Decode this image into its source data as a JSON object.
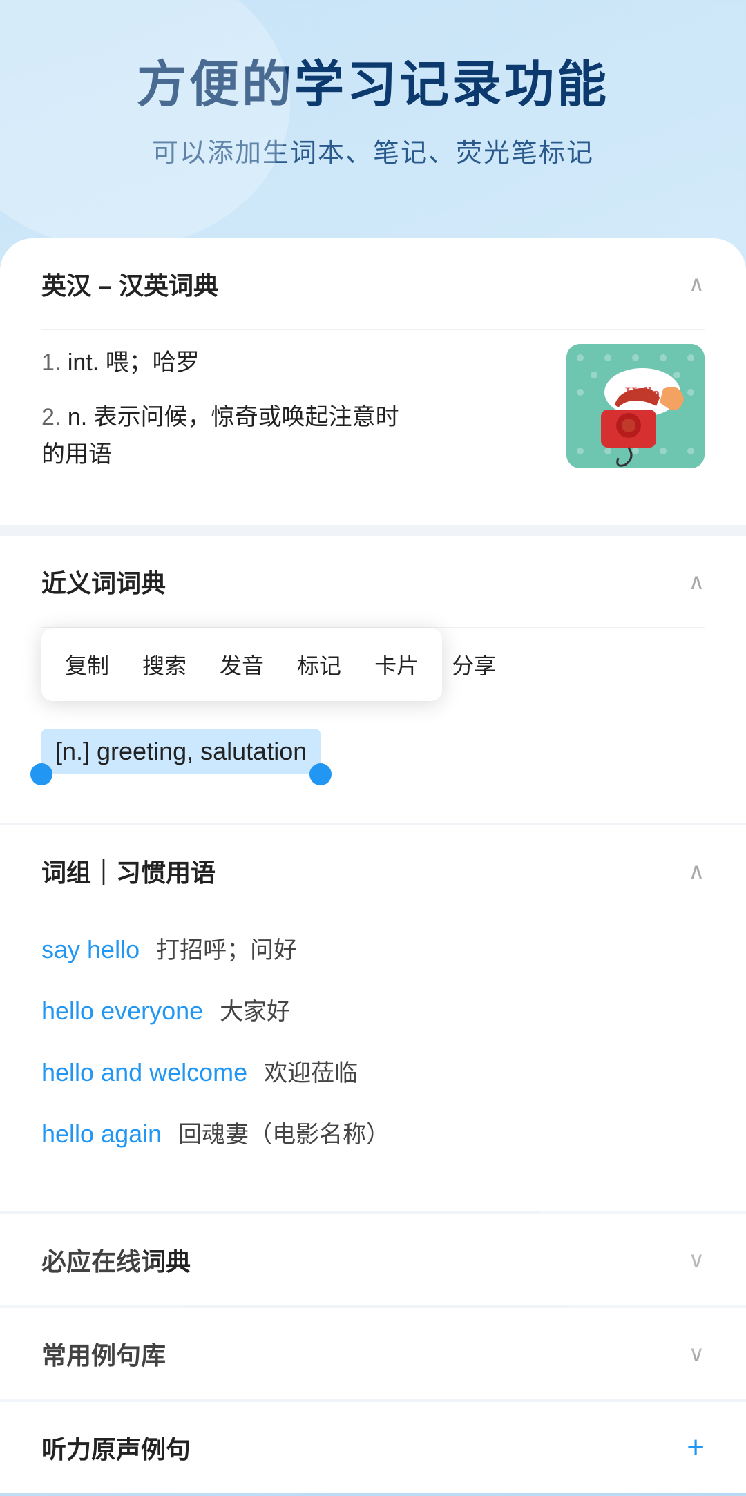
{
  "header": {
    "title": "方便的学习记录功能",
    "subtitle": "可以添加生词本、笔记、荧光笔标记"
  },
  "sections": {
    "dict": {
      "title": "英汉 – 汉英词典",
      "entries": [
        {
          "num": "1.",
          "type": "int.",
          "meaning": "喂；哈罗"
        },
        {
          "num": "2.",
          "type": "n.",
          "meaning": "表示问候，惊奇或唤起注意时的用语"
        }
      ]
    },
    "synonym": {
      "title": "近义词词典",
      "menu_items": [
        "复制",
        "搜索",
        "发音",
        "标记",
        "卡片",
        "分享"
      ],
      "selected_text": "[n.] greeting, salutation"
    },
    "phrases": {
      "title": "词组｜习惯用语",
      "items": [
        {
          "en": "say hello",
          "zh": "打招呼；问好"
        },
        {
          "en": "hello everyone",
          "zh": "大家好"
        },
        {
          "en": "hello and welcome",
          "zh": "欢迎莅临"
        },
        {
          "en": "hello again",
          "zh": "回魂妻（电影名称）"
        }
      ]
    },
    "byying": {
      "title": "必应在线词典"
    },
    "changyong": {
      "title": "常用例句库"
    },
    "tingli": {
      "title": "听力原声例句"
    }
  },
  "icons": {
    "chevron_up": "∧",
    "chevron_down": "∨",
    "plus": "+"
  }
}
